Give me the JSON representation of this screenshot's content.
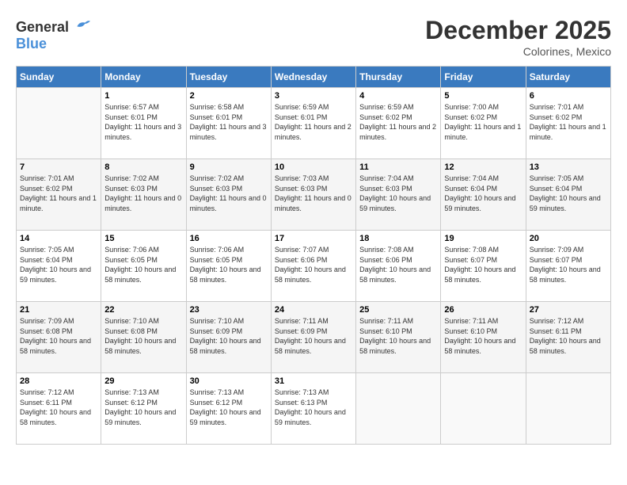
{
  "logo": {
    "general": "General",
    "blue": "Blue"
  },
  "title": {
    "month_year": "December 2025",
    "location": "Colorines, Mexico"
  },
  "days_of_week": [
    "Sunday",
    "Monday",
    "Tuesday",
    "Wednesday",
    "Thursday",
    "Friday",
    "Saturday"
  ],
  "weeks": [
    [
      {
        "day": "",
        "sunrise": "",
        "sunset": "",
        "daylight": ""
      },
      {
        "day": "1",
        "sunrise": "Sunrise: 6:57 AM",
        "sunset": "Sunset: 6:01 PM",
        "daylight": "Daylight: 11 hours and 3 minutes."
      },
      {
        "day": "2",
        "sunrise": "Sunrise: 6:58 AM",
        "sunset": "Sunset: 6:01 PM",
        "daylight": "Daylight: 11 hours and 3 minutes."
      },
      {
        "day": "3",
        "sunrise": "Sunrise: 6:59 AM",
        "sunset": "Sunset: 6:01 PM",
        "daylight": "Daylight: 11 hours and 2 minutes."
      },
      {
        "day": "4",
        "sunrise": "Sunrise: 6:59 AM",
        "sunset": "Sunset: 6:02 PM",
        "daylight": "Daylight: 11 hours and 2 minutes."
      },
      {
        "day": "5",
        "sunrise": "Sunrise: 7:00 AM",
        "sunset": "Sunset: 6:02 PM",
        "daylight": "Daylight: 11 hours and 1 minute."
      },
      {
        "day": "6",
        "sunrise": "Sunrise: 7:01 AM",
        "sunset": "Sunset: 6:02 PM",
        "daylight": "Daylight: 11 hours and 1 minute."
      }
    ],
    [
      {
        "day": "7",
        "sunrise": "Sunrise: 7:01 AM",
        "sunset": "Sunset: 6:02 PM",
        "daylight": "Daylight: 11 hours and 1 minute."
      },
      {
        "day": "8",
        "sunrise": "Sunrise: 7:02 AM",
        "sunset": "Sunset: 6:03 PM",
        "daylight": "Daylight: 11 hours and 0 minutes."
      },
      {
        "day": "9",
        "sunrise": "Sunrise: 7:02 AM",
        "sunset": "Sunset: 6:03 PM",
        "daylight": "Daylight: 11 hours and 0 minutes."
      },
      {
        "day": "10",
        "sunrise": "Sunrise: 7:03 AM",
        "sunset": "Sunset: 6:03 PM",
        "daylight": "Daylight: 11 hours and 0 minutes."
      },
      {
        "day": "11",
        "sunrise": "Sunrise: 7:04 AM",
        "sunset": "Sunset: 6:03 PM",
        "daylight": "Daylight: 10 hours and 59 minutes."
      },
      {
        "day": "12",
        "sunrise": "Sunrise: 7:04 AM",
        "sunset": "Sunset: 6:04 PM",
        "daylight": "Daylight: 10 hours and 59 minutes."
      },
      {
        "day": "13",
        "sunrise": "Sunrise: 7:05 AM",
        "sunset": "Sunset: 6:04 PM",
        "daylight": "Daylight: 10 hours and 59 minutes."
      }
    ],
    [
      {
        "day": "14",
        "sunrise": "Sunrise: 7:05 AM",
        "sunset": "Sunset: 6:04 PM",
        "daylight": "Daylight: 10 hours and 59 minutes."
      },
      {
        "day": "15",
        "sunrise": "Sunrise: 7:06 AM",
        "sunset": "Sunset: 6:05 PM",
        "daylight": "Daylight: 10 hours and 58 minutes."
      },
      {
        "day": "16",
        "sunrise": "Sunrise: 7:06 AM",
        "sunset": "Sunset: 6:05 PM",
        "daylight": "Daylight: 10 hours and 58 minutes."
      },
      {
        "day": "17",
        "sunrise": "Sunrise: 7:07 AM",
        "sunset": "Sunset: 6:06 PM",
        "daylight": "Daylight: 10 hours and 58 minutes."
      },
      {
        "day": "18",
        "sunrise": "Sunrise: 7:08 AM",
        "sunset": "Sunset: 6:06 PM",
        "daylight": "Daylight: 10 hours and 58 minutes."
      },
      {
        "day": "19",
        "sunrise": "Sunrise: 7:08 AM",
        "sunset": "Sunset: 6:07 PM",
        "daylight": "Daylight: 10 hours and 58 minutes."
      },
      {
        "day": "20",
        "sunrise": "Sunrise: 7:09 AM",
        "sunset": "Sunset: 6:07 PM",
        "daylight": "Daylight: 10 hours and 58 minutes."
      }
    ],
    [
      {
        "day": "21",
        "sunrise": "Sunrise: 7:09 AM",
        "sunset": "Sunset: 6:08 PM",
        "daylight": "Daylight: 10 hours and 58 minutes."
      },
      {
        "day": "22",
        "sunrise": "Sunrise: 7:10 AM",
        "sunset": "Sunset: 6:08 PM",
        "daylight": "Daylight: 10 hours and 58 minutes."
      },
      {
        "day": "23",
        "sunrise": "Sunrise: 7:10 AM",
        "sunset": "Sunset: 6:09 PM",
        "daylight": "Daylight: 10 hours and 58 minutes."
      },
      {
        "day": "24",
        "sunrise": "Sunrise: 7:11 AM",
        "sunset": "Sunset: 6:09 PM",
        "daylight": "Daylight: 10 hours and 58 minutes."
      },
      {
        "day": "25",
        "sunrise": "Sunrise: 7:11 AM",
        "sunset": "Sunset: 6:10 PM",
        "daylight": "Daylight: 10 hours and 58 minutes."
      },
      {
        "day": "26",
        "sunrise": "Sunrise: 7:11 AM",
        "sunset": "Sunset: 6:10 PM",
        "daylight": "Daylight: 10 hours and 58 minutes."
      },
      {
        "day": "27",
        "sunrise": "Sunrise: 7:12 AM",
        "sunset": "Sunset: 6:11 PM",
        "daylight": "Daylight: 10 hours and 58 minutes."
      }
    ],
    [
      {
        "day": "28",
        "sunrise": "Sunrise: 7:12 AM",
        "sunset": "Sunset: 6:11 PM",
        "daylight": "Daylight: 10 hours and 58 minutes."
      },
      {
        "day": "29",
        "sunrise": "Sunrise: 7:13 AM",
        "sunset": "Sunset: 6:12 PM",
        "daylight": "Daylight: 10 hours and 59 minutes."
      },
      {
        "day": "30",
        "sunrise": "Sunrise: 7:13 AM",
        "sunset": "Sunset: 6:12 PM",
        "daylight": "Daylight: 10 hours and 59 minutes."
      },
      {
        "day": "31",
        "sunrise": "Sunrise: 7:13 AM",
        "sunset": "Sunset: 6:13 PM",
        "daylight": "Daylight: 10 hours and 59 minutes."
      },
      {
        "day": "",
        "sunrise": "",
        "sunset": "",
        "daylight": ""
      },
      {
        "day": "",
        "sunrise": "",
        "sunset": "",
        "daylight": ""
      },
      {
        "day": "",
        "sunrise": "",
        "sunset": "",
        "daylight": ""
      }
    ]
  ]
}
